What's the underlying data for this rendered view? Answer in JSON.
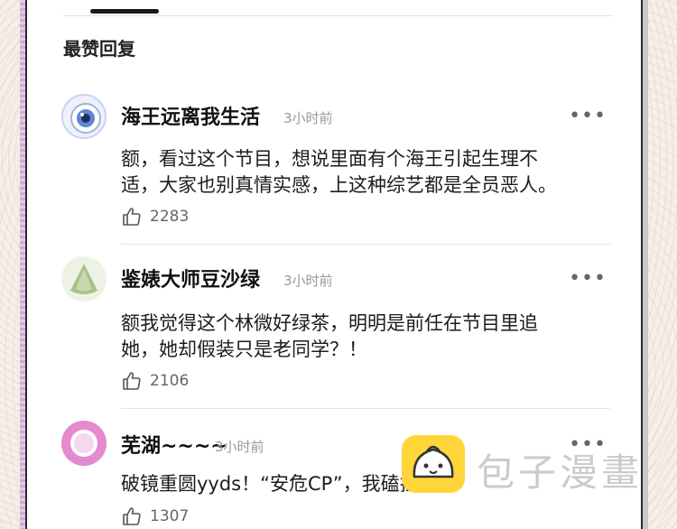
{
  "section": {
    "title": "最赞回复"
  },
  "comments": [
    {
      "username": "海王远离我生活",
      "time": "3小时前",
      "text_line1": "额，看过这个节目，想说里面有个海王引起生理不",
      "text_line2": "适，大家也别真情实感，上这种综艺都是全员恶人。",
      "likes": "2283"
    },
    {
      "username": "鉴婊大师豆沙绿",
      "time": "3小时前",
      "text_line1": "额我觉得这个林微好绿茶，明明是前任在节目里追",
      "text_line2": "她，她却假装只是老同学？！",
      "likes": "2106"
    },
    {
      "username": "芜湖~~~~",
      "time": "3小时前",
      "text_line1": "破镜重圆yyds！“安危CP”，我磕拉了！",
      "likes": "1307"
    }
  ],
  "icons": {
    "more": "ellipsis-icon",
    "like": "thumbs-up-icon"
  },
  "watermark": {
    "text": "包子漫畫"
  }
}
